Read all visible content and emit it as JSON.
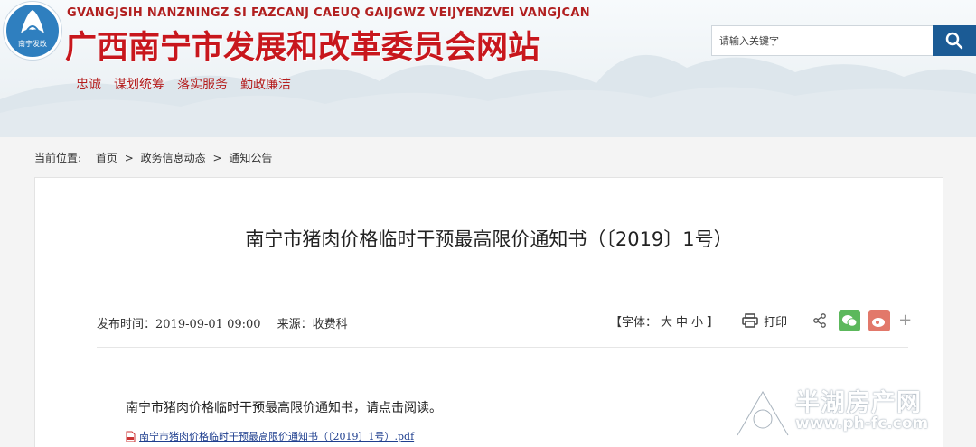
{
  "header": {
    "logo_text": "南宁发改",
    "pinyin": "GVANGJSIH NANZNINGZ SI FAZCANJ CAEUQ GAIJGWZ VEIJYENZVEI VANGJCAN",
    "site_title": "广西南宁市发展和改革委员会网站",
    "nav": [
      "忠诚",
      "谋划统筹",
      "落实服务",
      "勤政廉洁"
    ],
    "search": {
      "placeholder": "请输入关键字"
    }
  },
  "breadcrumb": {
    "label": "当前位置:",
    "items": [
      "首页",
      "政务信息动态",
      "通知公告"
    ],
    "separator": ">"
  },
  "article": {
    "title": "南宁市猪肉价格临时干预最高限价通知书（〔2019〕1号）",
    "publish_time": "发布时间：2019-09-01 09:00",
    "source": "来源：收费科",
    "font_size_label": "【字体：",
    "font_sizes": [
      "大",
      "中",
      "小"
    ],
    "font_size_end": "】",
    "print_label": "打印",
    "body_text": "南宁市猪肉价格临时干预最高限价通知书，请点击阅读。",
    "attachment": "南宁市猪肉价格临时干预最高限价通知书（〔2019〕1号）.pdf",
    "share_plus": "+"
  },
  "watermark": {
    "site_name": "半湖房产网",
    "url": "www.ph-fc.com"
  },
  "colors": {
    "title_red": "#c8171d",
    "search_button": "#1b5b95",
    "wechat": "#5cb85c",
    "weibo": "#e2786a"
  }
}
